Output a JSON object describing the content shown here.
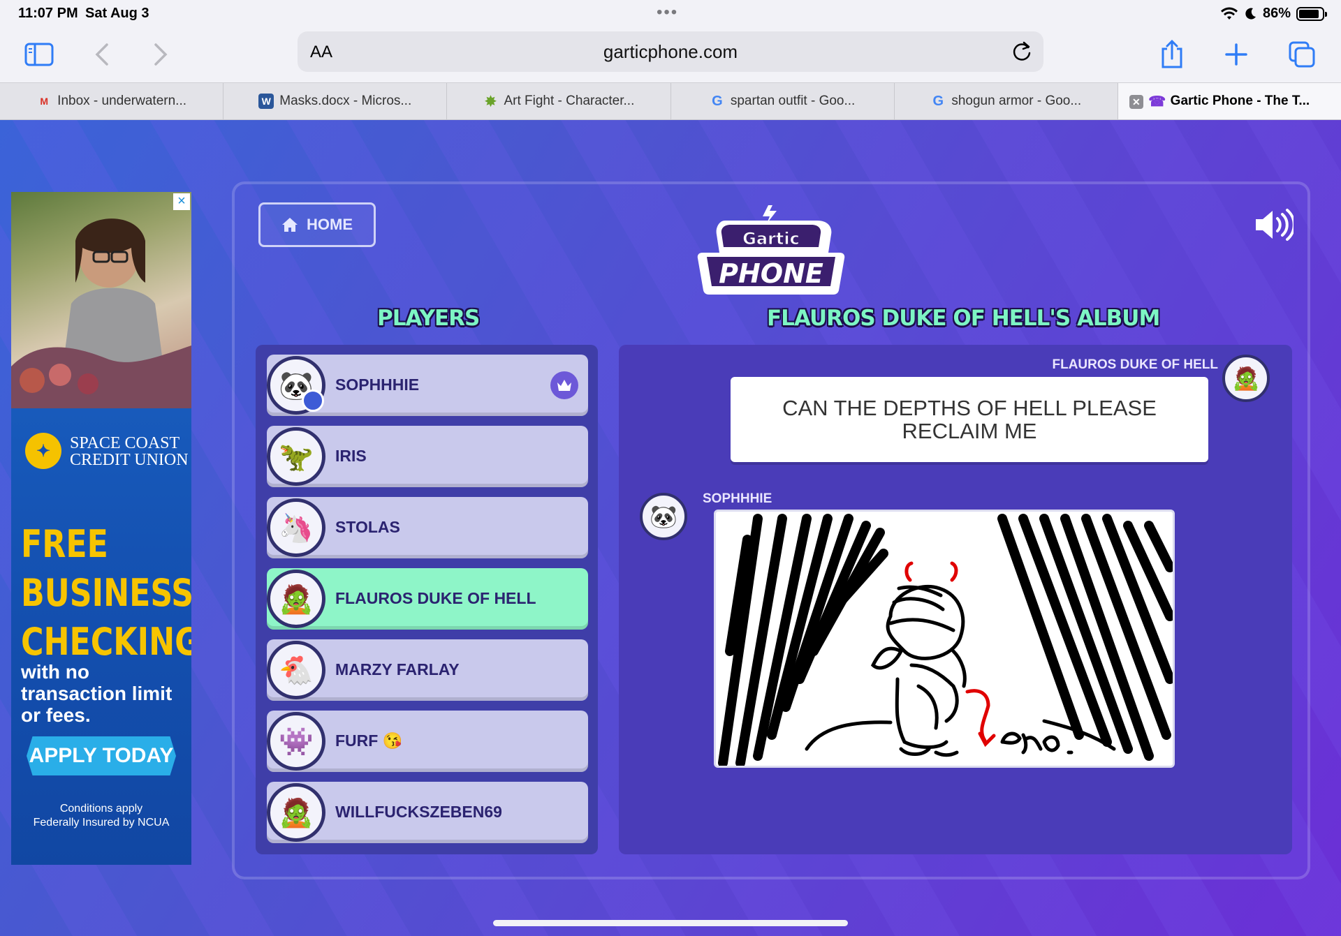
{
  "status": {
    "time": "11:07 PM",
    "date": "Sat Aug 3",
    "battery": "86%",
    "battery_level": 0.86
  },
  "browser": {
    "aa_label": "AA",
    "url": "garticphone.com",
    "tabs": [
      {
        "label": "Inbox - underwatern...",
        "favicon": "gmail-icon",
        "favicon_char": "M",
        "color": "#d93025"
      },
      {
        "label": "Masks.docx - Micros...",
        "favicon": "word-icon",
        "favicon_char": "W",
        "color": "#2b579a"
      },
      {
        "label": "Art Fight - Character...",
        "favicon": "art-fight-icon",
        "favicon_char": "✸",
        "color": "#6aa32a"
      },
      {
        "label": "spartan outfit - Goo...",
        "favicon": "google-icon",
        "favicon_char": "G",
        "color": "#4285f4"
      },
      {
        "label": "shogun armor - Goo...",
        "favicon": "google-icon",
        "favicon_char": "G",
        "color": "#4285f4"
      },
      {
        "label": "Gartic Phone - The T...",
        "favicon": "gartic-phone-icon",
        "favicon_char": "☎",
        "color": "#7c3ad8"
      }
    ]
  },
  "ad": {
    "brand": "SPACE COAST CREDIT UNION",
    "headline": "FREE BUSINESS CHECKING",
    "sub": "with no transaction limit or fees.",
    "cta": "APPLY TODAY",
    "fine_1": "Conditions apply",
    "fine_2": "Federally Insured by NCUA"
  },
  "game": {
    "home_label": "HOME",
    "logo_top": "Gartic",
    "logo_bottom": "PHONE",
    "players_title": "PLAYERS",
    "album_title": "FLAUROS DUKE OF HELL'S ALBUM",
    "players": [
      {
        "name": "SOPHHHIE",
        "avatar": "panda-avatar",
        "avatar_char": "🐼",
        "host": true,
        "highlight": false
      },
      {
        "name": "IRIS",
        "avatar": "dino-avatar",
        "avatar_char": "🦖",
        "host": false,
        "highlight": false
      },
      {
        "name": "STOLAS",
        "avatar": "unicorn-avatar",
        "avatar_char": "🦄",
        "host": false,
        "highlight": false
      },
      {
        "name": "FLAUROS DUKE OF HELL",
        "avatar": "mummy-avatar",
        "avatar_char": "🧟",
        "host": false,
        "highlight": true
      },
      {
        "name": "MARZY FARLAY",
        "avatar": "rooster-avatar",
        "avatar_char": "🐔",
        "host": false,
        "highlight": false
      },
      {
        "name": "FURF 😘",
        "avatar": "blob-avatar",
        "avatar_char": "👾",
        "host": false,
        "highlight": false
      },
      {
        "name": "WILLFUCKSZEBEN69",
        "avatar": "mummy-avatar",
        "avatar_char": "🧟",
        "host": false,
        "highlight": false
      }
    ],
    "album": {
      "entry1_author": "FLAUROS DUKE OF HELL",
      "entry1_text": "CAN THE DEPTHS OF HELL PLEASE RECLAIM ME",
      "entry2_author": "SOPHHHIE",
      "drawing_caption": "emo."
    }
  },
  "colors": {
    "accent_mint": "#7df5c4",
    "panel": "#3f3ea8",
    "highlight": "#8ef5c8"
  }
}
